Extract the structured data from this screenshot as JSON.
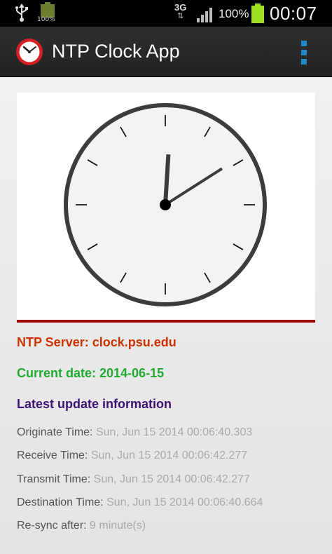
{
  "status_bar": {
    "small_battery_label": "100%",
    "network_type": "3G",
    "network_arrows": "⇅",
    "battery_percent": "100%",
    "time": "00:07",
    "battery_color": "#9be024"
  },
  "action_bar": {
    "title": "NTP Clock App",
    "icons": [
      "clock-app-icon",
      "overflow-menu-icon"
    ]
  },
  "clock": {
    "hour": 0,
    "minute": 7,
    "face_color": "#f3f3f3",
    "rim_color": "#3c3c3c",
    "border_color": "#990000"
  },
  "info": {
    "server_label": "NTP Server: clock.psu.edu",
    "date_label": "Current date: 2014-06-15",
    "latest_heading": "Latest update information",
    "rows": [
      {
        "label": "Originate Time: ",
        "value": "Sun, Jun 15 2014 00:06:40.303"
      },
      {
        "label": "Receive Time: ",
        "value": "Sun, Jun 15 2014 00:06:42.277"
      },
      {
        "label": "Transmit Time: ",
        "value": "Sun, Jun 15 2014 00:06:42.277"
      },
      {
        "label": "Destination Time: ",
        "value": "Sun, Jun 15 2014 00:06:40.664"
      },
      {
        "label": "Re-sync after: ",
        "value": "9 minute(s)"
      }
    ]
  }
}
